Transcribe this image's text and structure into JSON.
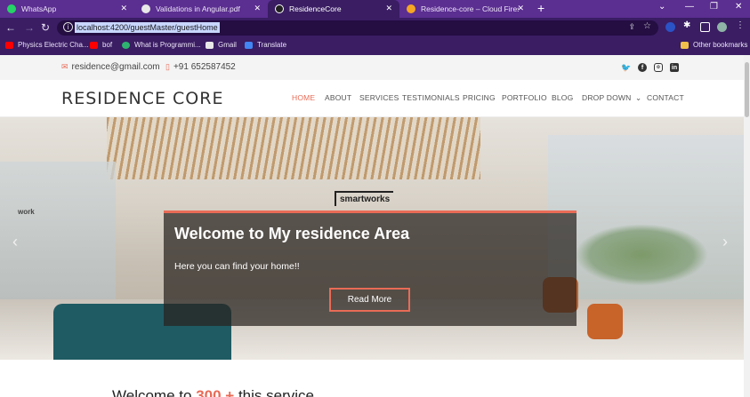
{
  "browser": {
    "tabs": [
      {
        "label": "WhatsApp",
        "icon": "whatsapp-icon",
        "color": "#25d366"
      },
      {
        "label": "Validations in Angular.pdf",
        "icon": "globe-icon",
        "color": "#e8e8e8"
      },
      {
        "label": "ResidenceCore",
        "icon": "angular-icon",
        "color": "#222222"
      },
      {
        "label": "Residence-core – Cloud Firestore",
        "icon": "firebase-icon",
        "color": "#f5a623"
      }
    ],
    "active_tab": 2,
    "url": "localhost:4200/guestMaster/guestHome",
    "bookmarks": [
      {
        "label": "Physics Electric Cha...",
        "icon": "youtube-icon",
        "color": "#ff0000"
      },
      {
        "label": "bof",
        "icon": "youtube-icon",
        "color": "#ff0000"
      },
      {
        "label": "What is Programmi...",
        "icon": "blog-icon",
        "color": "#2db36f"
      },
      {
        "label": "Gmail",
        "icon": "gmail-icon",
        "color": "#e8e8e8"
      },
      {
        "label": "Translate",
        "icon": "translate-icon",
        "color": "#4285f4"
      }
    ],
    "other_bookmarks": "Other bookmarks"
  },
  "site": {
    "email": "residence@gmail.com",
    "phone": "+91 652587452",
    "logo": "RESIDENCE CORE",
    "nav": [
      "HOME",
      "ABOUT",
      "SERVICES",
      "TESTIMONIALS",
      "PRICING",
      "PORTFOLIO",
      "BLOG",
      "DROP DOWN",
      "CONTACT"
    ],
    "active_nav": "HOME",
    "accent": "#e96b56"
  },
  "hero": {
    "sign": "smartworks",
    "wall_text": "work",
    "title": "Welcome to My residence Area",
    "subtitle": "Here you can find your home!!",
    "button": "Read More"
  },
  "section": {
    "prefix": "Welcome to",
    "highlight": "300 + ",
    "suffix": "this service"
  }
}
